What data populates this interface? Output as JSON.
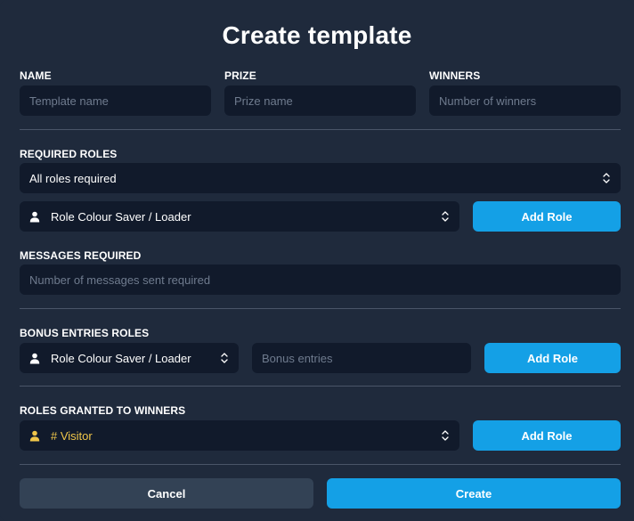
{
  "title": "Create template",
  "name": {
    "label": "NAME",
    "placeholder": "Template name"
  },
  "prize": {
    "label": "PRIZE",
    "placeholder": "Prize name"
  },
  "winners": {
    "label": "WINNERS",
    "placeholder": "Number of winners"
  },
  "required_roles": {
    "label": "REQUIRED ROLES",
    "mode_select": "All roles required",
    "role_select": "Role Colour Saver / Loader",
    "add_button": "Add Role"
  },
  "messages_required": {
    "label": "MESSAGES REQUIRED",
    "placeholder": "Number of messages sent required"
  },
  "bonus_entries": {
    "label": "BONUS ENTRIES ROLES",
    "role_select": "Role Colour Saver / Loader",
    "entries_placeholder": "Bonus entries",
    "add_button": "Add Role"
  },
  "granted_roles": {
    "label": "ROLES GRANTED TO WINNERS",
    "role_select": "# Visitor",
    "add_button": "Add Role"
  },
  "footer": {
    "cancel_label": "Cancel",
    "create_label": "Create"
  },
  "colors": {
    "background": "#1f2a3c",
    "field": "#111a2b",
    "accent": "#14a0e6",
    "cancel": "#334255",
    "role_gold": "#f0c64a"
  }
}
